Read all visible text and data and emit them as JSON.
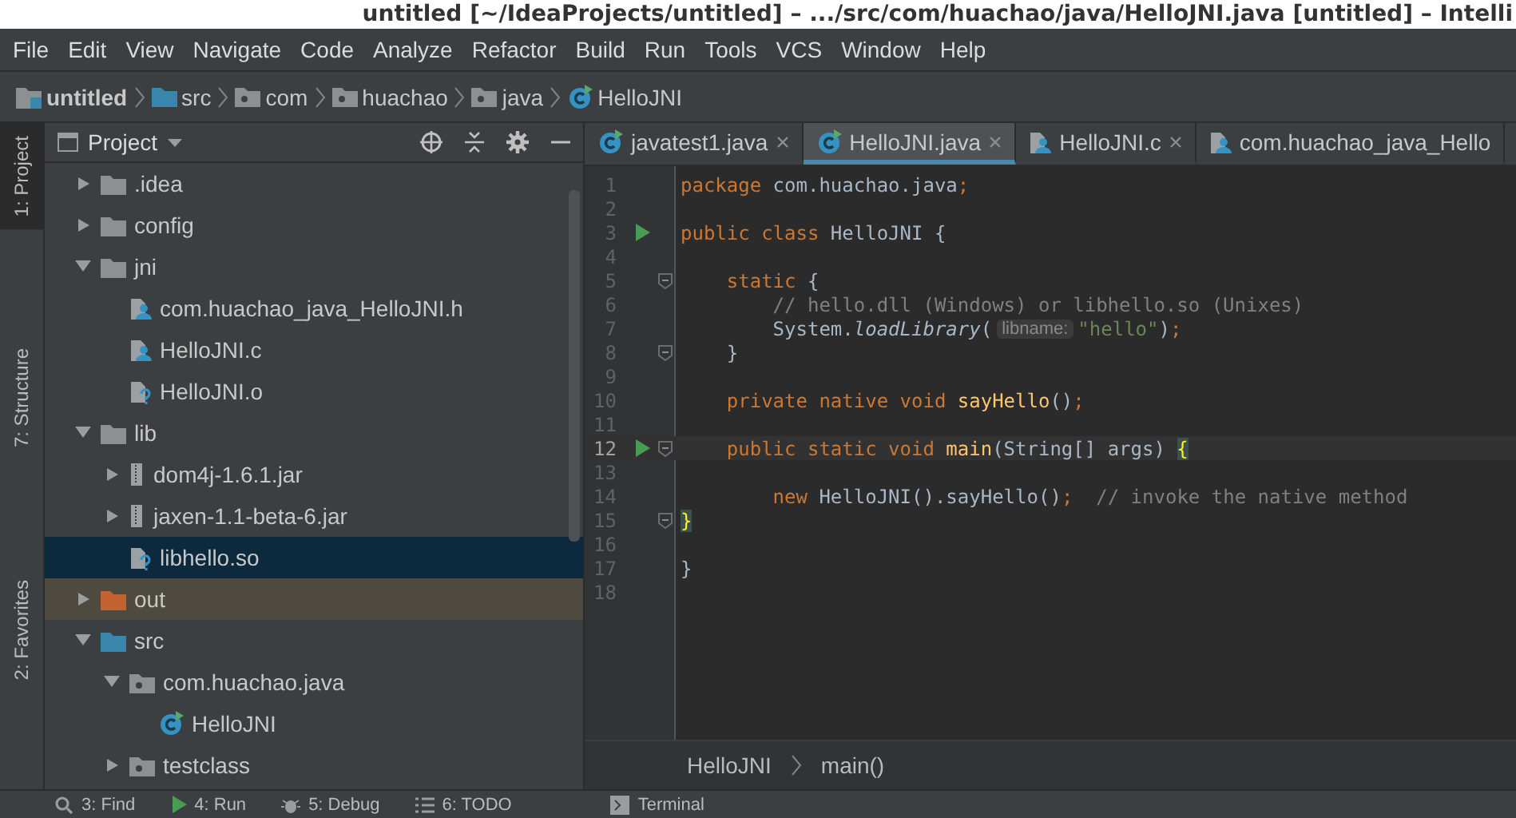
{
  "window": {
    "title": "untitled [~/IdeaProjects/untitled] – .../src/com/huachao/java/HelloJNI.java [untitled] – Intelli"
  },
  "menu": [
    "File",
    "Edit",
    "View",
    "Navigate",
    "Code",
    "Analyze",
    "Refactor",
    "Build",
    "Run",
    "Tools",
    "VCS",
    "Window",
    "Help"
  ],
  "breadcrumbs": [
    {
      "kind": "module",
      "label": "untitled"
    },
    {
      "kind": "source-folder",
      "label": "src"
    },
    {
      "kind": "package",
      "label": "com"
    },
    {
      "kind": "package",
      "label": "huachao"
    },
    {
      "kind": "package",
      "label": "java"
    },
    {
      "kind": "class",
      "label": "HelloJNI"
    }
  ],
  "left_stripe": [
    {
      "label": "1: Project",
      "selected": true
    },
    {
      "label": "7: Structure",
      "selected": false
    },
    {
      "label": "2: Favorites",
      "selected": false
    }
  ],
  "project_panel": {
    "title": "Project",
    "tree": [
      {
        "kind": "folder",
        "label": ".idea",
        "expanded": false,
        "selected": false,
        "excluded": false
      },
      {
        "kind": "folder",
        "label": "config",
        "expanded": false,
        "selected": false,
        "excluded": false
      },
      {
        "kind": "folder",
        "label": "jni",
        "expanded": true,
        "selected": false,
        "excluded": false,
        "children": [
          {
            "kind": "c-file",
            "label": "com.huachao_java_HelloJNI.h",
            "selected": false,
            "excluded": false
          },
          {
            "kind": "c-file",
            "label": "HelloJNI.c",
            "selected": false,
            "excluded": false
          },
          {
            "kind": "unknown-file",
            "label": "HelloJNI.o",
            "selected": false,
            "excluded": false
          }
        ]
      },
      {
        "kind": "folder",
        "label": "lib",
        "expanded": true,
        "selected": false,
        "excluded": false,
        "children": [
          {
            "kind": "jar",
            "label": "dom4j-1.6.1.jar",
            "expanded": false,
            "selected": false,
            "excluded": false
          },
          {
            "kind": "jar",
            "label": "jaxen-1.1-beta-6.jar",
            "expanded": false,
            "selected": false,
            "excluded": false
          },
          {
            "kind": "unknown-file",
            "label": "libhello.so",
            "selected": true,
            "excluded": false
          }
        ]
      },
      {
        "kind": "folder",
        "label": "out",
        "expanded": false,
        "selected": false,
        "excluded": true
      },
      {
        "kind": "source-folder",
        "label": "src",
        "expanded": true,
        "selected": false,
        "excluded": false,
        "children": [
          {
            "kind": "package",
            "label": "com.huachao.java",
            "expanded": true,
            "selected": false,
            "excluded": false,
            "children": [
              {
                "kind": "class",
                "label": "HelloJNI",
                "selected": false,
                "excluded": false
              }
            ]
          },
          {
            "kind": "package",
            "label": "testclass",
            "expanded": false,
            "selected": false,
            "excluded": false
          }
        ]
      }
    ]
  },
  "editor": {
    "tabs": [
      {
        "kind": "class",
        "label": "javatest1.java",
        "selected": false
      },
      {
        "kind": "class",
        "label": "HelloJNI.java",
        "selected": true
      },
      {
        "kind": "c-file",
        "label": "HelloJNI.c",
        "selected": false
      },
      {
        "kind": "c-file",
        "label": "com.huachao_java_Hello",
        "selected": false
      }
    ],
    "lines": [
      {
        "number": "1",
        "run": false,
        "fold": false,
        "current": false,
        "tokens": [
          {
            "kind": "keyword",
            "text": "package"
          },
          {
            "kind": "plain",
            "text": " com.huachao.java"
          },
          {
            "kind": "keyword",
            "text": ";"
          }
        ]
      },
      {
        "number": "2",
        "run": false,
        "fold": false,
        "current": false
      },
      {
        "number": "3",
        "run": true,
        "fold": false,
        "current": false,
        "tokens": [
          {
            "kind": "keyword",
            "text": "public class"
          },
          {
            "kind": "plain",
            "text": " HelloJNI {"
          }
        ]
      },
      {
        "number": "4",
        "run": false,
        "fold": false,
        "current": false
      },
      {
        "number": "5",
        "run": false,
        "fold": true,
        "current": false,
        "tokens": [
          {
            "kind": "keyword",
            "text": "    static"
          },
          {
            "kind": "plain",
            "text": " {"
          }
        ]
      },
      {
        "number": "6",
        "run": false,
        "fold": false,
        "current": false,
        "tokens": [
          {
            "kind": "comment",
            "text": "        // hello.dll (Windows) or libhello.so (Unixes)"
          }
        ]
      },
      {
        "number": "7",
        "run": false,
        "fold": false,
        "current": false,
        "tokens": [
          {
            "kind": "plain",
            "text": "        System."
          },
          {
            "kind": "call",
            "text": "loadLibrary"
          },
          {
            "kind": "plain",
            "text": "("
          },
          {
            "kind": "hint",
            "text": "libname:"
          },
          {
            "kind": "string",
            "text": "\"hello\""
          },
          {
            "kind": "plain",
            "text": ")"
          },
          {
            "kind": "keyword",
            "text": ";"
          }
        ]
      },
      {
        "number": "8",
        "run": false,
        "fold": true,
        "current": false,
        "tokens": [
          {
            "kind": "plain",
            "text": "    }"
          }
        ]
      },
      {
        "number": "9",
        "run": false,
        "fold": false,
        "current": false
      },
      {
        "number": "10",
        "run": false,
        "fold": false,
        "current": false,
        "tokens": [
          {
            "kind": "keyword",
            "text": "    private native void"
          },
          {
            "kind": "method",
            "text": " sayHello"
          },
          {
            "kind": "plain",
            "text": "()"
          },
          {
            "kind": "keyword",
            "text": ";"
          }
        ]
      },
      {
        "number": "11",
        "run": false,
        "fold": false,
        "current": false
      },
      {
        "number": "12",
        "run": true,
        "fold": true,
        "current": true,
        "tokens": [
          {
            "kind": "keyword",
            "text": "    public static void"
          },
          {
            "kind": "method",
            "text": " main"
          },
          {
            "kind": "plain",
            "text": "(String[] args) "
          },
          {
            "kind": "brace",
            "text": "{"
          }
        ]
      },
      {
        "number": "13",
        "run": false,
        "fold": false,
        "current": false
      },
      {
        "number": "14",
        "run": false,
        "fold": false,
        "current": false,
        "tokens": [
          {
            "kind": "keyword",
            "text": "        new"
          },
          {
            "kind": "plain",
            "text": " HelloJNI().sayHello()"
          },
          {
            "kind": "keyword",
            "text": ";"
          },
          {
            "kind": "comment",
            "text": "  // invoke the native method"
          }
        ]
      },
      {
        "number": "15",
        "run": false,
        "fold": true,
        "current": false,
        "tokens": [
          {
            "kind": "brace",
            "text": "    }"
          }
        ]
      },
      {
        "number": "16",
        "run": false,
        "fold": false,
        "current": false
      },
      {
        "number": "17",
        "run": false,
        "fold": false,
        "current": false,
        "tokens": [
          {
            "kind": "plain",
            "text": "}"
          }
        ]
      },
      {
        "number": "18",
        "run": false,
        "fold": false,
        "current": false
      }
    ],
    "breadcrumbs": [
      "HelloJNI",
      "main()"
    ]
  },
  "bottom_tools": [
    {
      "kind": "find",
      "label": "3: Find"
    },
    {
      "kind": "run",
      "label": "4: Run"
    },
    {
      "kind": "debug",
      "label": "5: Debug"
    },
    {
      "kind": "todo",
      "label": "6: TODO"
    },
    {
      "kind": "terminal",
      "label": "Terminal"
    }
  ]
}
